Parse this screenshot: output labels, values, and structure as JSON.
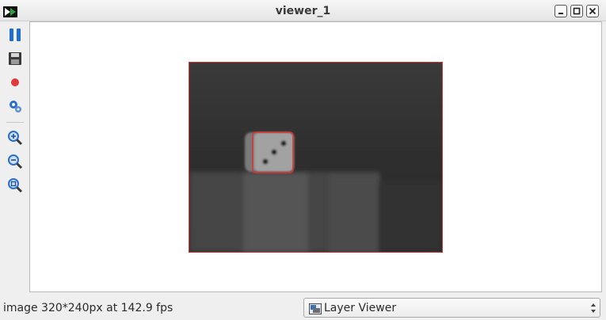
{
  "window": {
    "title": "viewer_1"
  },
  "toolbar": {
    "tools": [
      {
        "name": "pause",
        "icon": "pause-icon"
      },
      {
        "name": "save",
        "icon": "floppy-disk-icon"
      },
      {
        "name": "record",
        "icon": "record-icon"
      },
      {
        "name": "settings",
        "icon": "gears-icon"
      },
      {
        "name": "zoom-in",
        "icon": "zoom-in-icon"
      },
      {
        "name": "zoom-out",
        "icon": "zoom-out-icon"
      },
      {
        "name": "zoom-fit",
        "icon": "zoom-fit-icon"
      }
    ]
  },
  "viewer": {
    "frame_border_color": "#d23a3a",
    "detection_box_color": "#e23030"
  },
  "status": {
    "text": "image 320*240px at 142.9 fps"
  },
  "layer_select": {
    "selected": "Layer Viewer",
    "icon": "layer-viewer-icon"
  },
  "colors": {
    "accent_blue": "#1f6fd1",
    "record_red": "#e03a3a"
  }
}
